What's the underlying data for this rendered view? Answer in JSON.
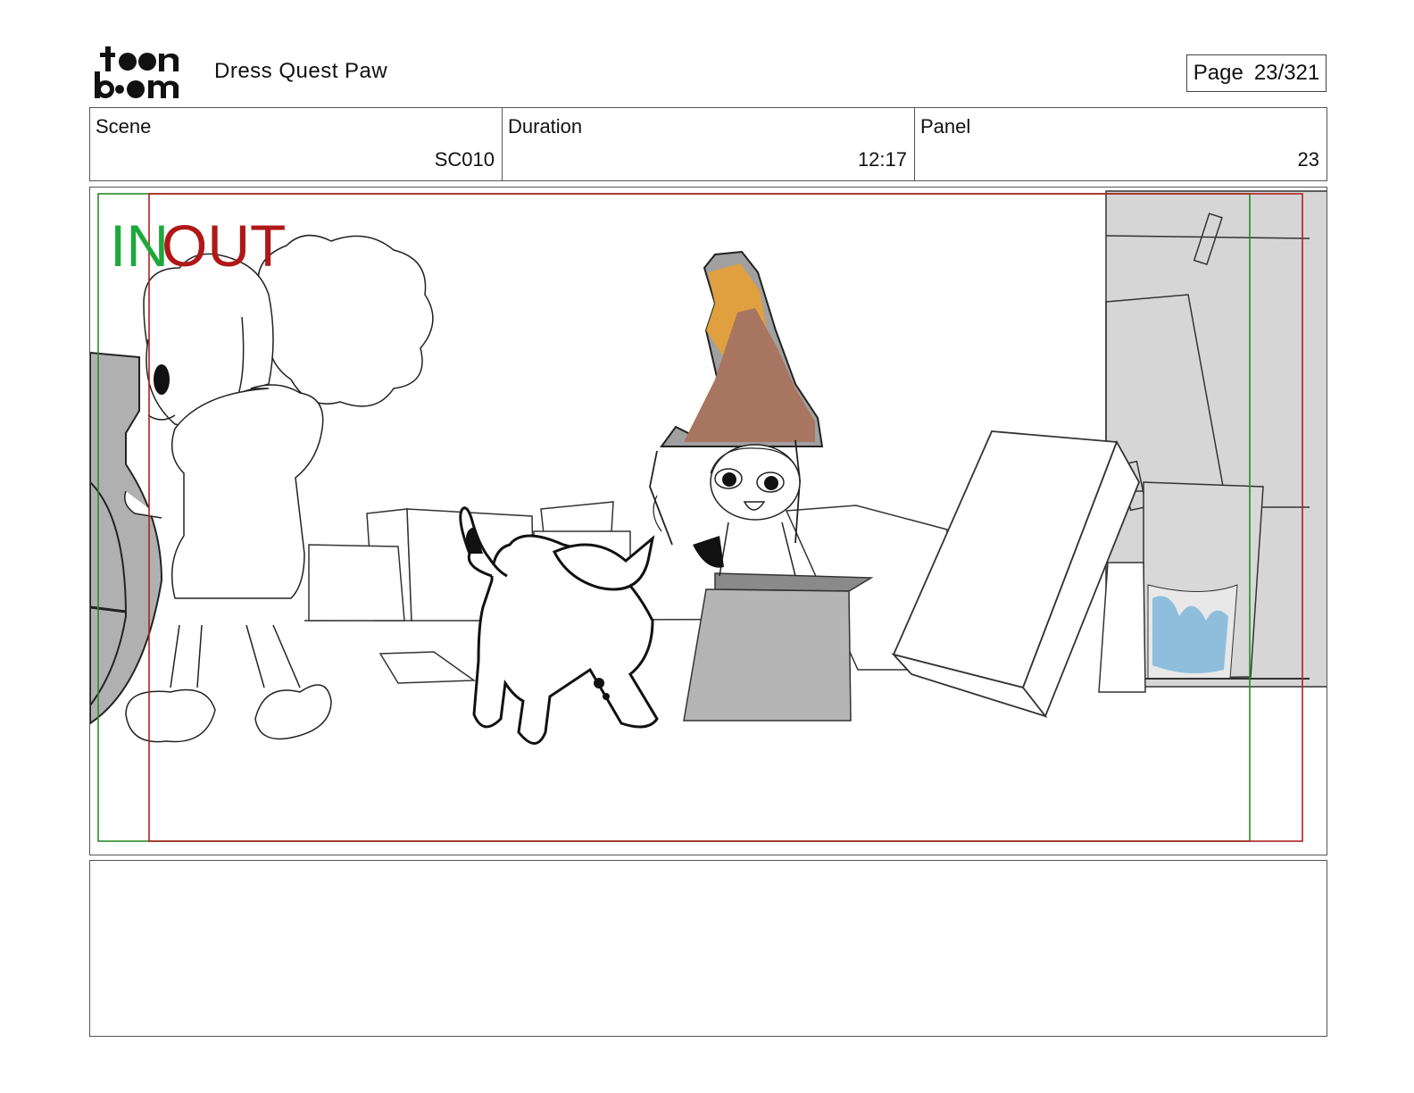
{
  "header": {
    "logo_text": "toonboom",
    "project_title": "Dress Quest Paw",
    "page_label": "Page",
    "page_value": "23/321"
  },
  "info": {
    "scene_label": "Scene",
    "scene_value": "SC010",
    "duration_label": "Duration",
    "duration_value": "12:17",
    "panel_label": "Panel",
    "panel_value": "23"
  },
  "artwork": {
    "in_marker": "IN",
    "out_marker": "OUT",
    "in_color": "#1ea83c",
    "out_color": "#b01818",
    "hat_orange": "#e0a040",
    "hat_brown": "#a87560",
    "poster_blue": "#8ebedc"
  },
  "notes": {
    "text": ""
  }
}
